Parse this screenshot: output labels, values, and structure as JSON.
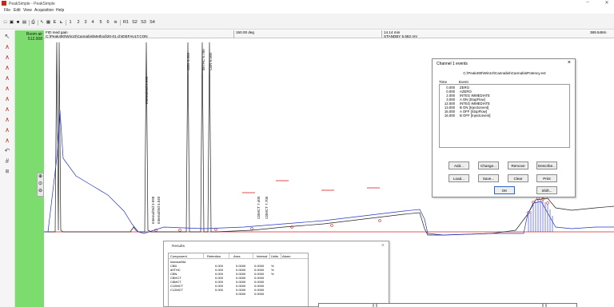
{
  "window": {
    "title": "PeakSimple - PeakSimple",
    "minimize": "–",
    "close": "✕"
  },
  "menu": [
    "File",
    "Edit",
    "View",
    "Acquisition",
    "Help"
  ],
  "toolbar": {
    "numbers": [
      "1",
      "2",
      "3",
      "4",
      "5",
      "6"
    ],
    "r1": "R1",
    "s2": "S2",
    "s3": "S3",
    "s4": "S4"
  },
  "green_panel": {
    "label1": "Room air",
    "label2": "512.008"
  },
  "info_bar": {
    "detector": "FID med gain",
    "method_path": "C:\\Peak490\\Win10\\Cannabis\\Method\\20-01.chrDEFAULT.CON",
    "temperature": "150.00 deg",
    "time": "14.14 min",
    "status": "STANDBY 5.582 mV",
    "right_value": "389.548m"
  },
  "chart_data": {
    "type": "line",
    "peak_labels": [
      "InternalStd 3.990",
      "CBD 5.306",
      "d9THC 6.786",
      "CBN 6.500",
      "InternalStd 3.998",
      "InternalStd 4.040",
      "CBMCT 7.400",
      "CBMCT 7.706"
    ]
  },
  "channel_events": {
    "title": "Channel 1 events",
    "path": "C:\\Peak490\\Win10\\Cannabis\\CannabisPotency.evt",
    "col_time": "Time",
    "col_event": "Event",
    "events": [
      {
        "time": "0.000",
        "event": "ZERO"
      },
      {
        "time": "0.000",
        "event": "AZERO"
      },
      {
        "time": "2.000",
        "event": "INTEG IMMEDIATE"
      },
      {
        "time": "3.000",
        "event": "A ON [StopFlow]"
      },
      {
        "time": "12.500",
        "event": "INTEG IMMEDIATE"
      },
      {
        "time": "13.000",
        "event": "B ON [Injectorvent]"
      },
      {
        "time": "16.000",
        "event": "A OFF [StopFlow]"
      },
      {
        "time": "16.000",
        "event": "B OFF [Injectorvent]"
      }
    ],
    "buttons": {
      "add": "Add...",
      "change": "Change...",
      "remove": "Remove",
      "describe": "Describe...",
      "load": "Load...",
      "save": "Save...",
      "clear": "Clear",
      "print": "Print",
      "ok": "OK",
      "shift": "Shift..."
    }
  },
  "results": {
    "title": "Results",
    "columns": [
      "Component",
      "Retention",
      "Area",
      "Internal",
      "Units",
      "Alarm"
    ],
    "rows": [
      {
        "component": "InternalStd",
        "retention": "",
        "area": "",
        "internal": ""
      },
      {
        "component": "CBD",
        "retention": "0.000",
        "area": "0.0000",
        "internal": "0.0000",
        "units": "%"
      },
      {
        "component": "d9THC",
        "retention": "0.000",
        "area": "0.0000",
        "internal": "0.0000",
        "units": "%"
      },
      {
        "component": "CBN",
        "retention": "0.000",
        "area": "0.0000",
        "internal": "0.0000",
        "units": "%"
      },
      {
        "component": "CBHCT",
        "retention": "0.000",
        "area": "0.0000",
        "internal": "0.0000"
      },
      {
        "component": "C8MCT",
        "retention": "0.000",
        "area": "0.0000",
        "internal": "0.0000"
      },
      {
        "component": "C10MCT",
        "retention": "0.000",
        "area": "0.0000",
        "internal": "0.0000"
      },
      {
        "component": "C12MCT",
        "retention": "0.000",
        "area": "0.0000",
        "internal": "0.0000"
      },
      {
        "component": "",
        "retention": "",
        "area": "0.0000",
        "internal": "0.0000"
      }
    ]
  },
  "colors": {
    "green_panel": "#7ddc6e",
    "baseline_red": "#d92020",
    "trace_blue": "#2433c8",
    "trace_black": "#222222",
    "app_icon": "#c8261c",
    "tool_icon_red": "#c8261c"
  },
  "icons": {
    "app": "peaksimple-logo-icon",
    "left_tools": [
      "pointer-icon",
      "chromatogram-icon",
      "chromatogram-icon",
      "chromatogram-icon",
      "chromatogram-icon",
      "chromatogram-icon",
      "chromatogram-icon",
      "chromatogram-icon",
      "chromatogram-icon",
      "chromatogram-icon",
      "chromatogram-icon",
      "undo-icon",
      "grid-icon",
      "tool-icon"
    ],
    "zoom": [
      "zoom-in-icon",
      "zoom-reset-icon",
      "zoom-out-icon"
    ]
  }
}
